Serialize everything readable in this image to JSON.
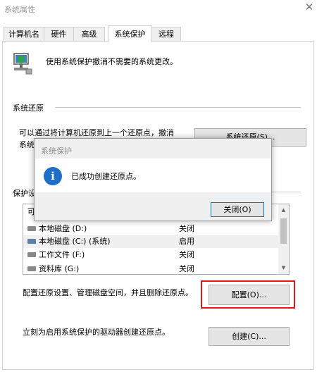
{
  "window": {
    "title": "系统属性"
  },
  "tabs": [
    {
      "label": "计算机名"
    },
    {
      "label": "硬件"
    },
    {
      "label": "高级"
    },
    {
      "label": "系统保护"
    },
    {
      "label": "远程"
    }
  ],
  "intro_text": "使用系统保护撤消不需要的系统更改。",
  "restore": {
    "section_label": "系统还原",
    "line1": "可以通过将计算机还原到上一个还原点，撤消",
    "line2": "系统",
    "button_label": "系统还原(S)..."
  },
  "protection": {
    "section_label": "保护设",
    "header_partial": "可",
    "drives": [
      {
        "name": "本地磁盘 (D:)",
        "status": "关闭",
        "system": false
      },
      {
        "name": "本地磁盘 (C:) (系统)",
        "status": "启用",
        "system": true
      },
      {
        "name": "工作文件 (F:)",
        "status": "关闭",
        "system": false
      },
      {
        "name": "资料库 (G:)",
        "status": "关闭",
        "system": false
      }
    ],
    "configure_text": "配置还原设置、管理磁盘空间，并且删除还原点。",
    "configure_button": "配置(O)...",
    "create_text": "立刻为启用系统保护的驱动器创建还原点。",
    "create_button": "创建(C)..."
  },
  "dialog": {
    "title": "系统保护",
    "message": "已成功创建还原点。",
    "close_button": "关闭(O)"
  },
  "colors": {
    "highlight": "#e01818",
    "accent": "#0078d7",
    "info_icon": "#1f6fc9"
  }
}
